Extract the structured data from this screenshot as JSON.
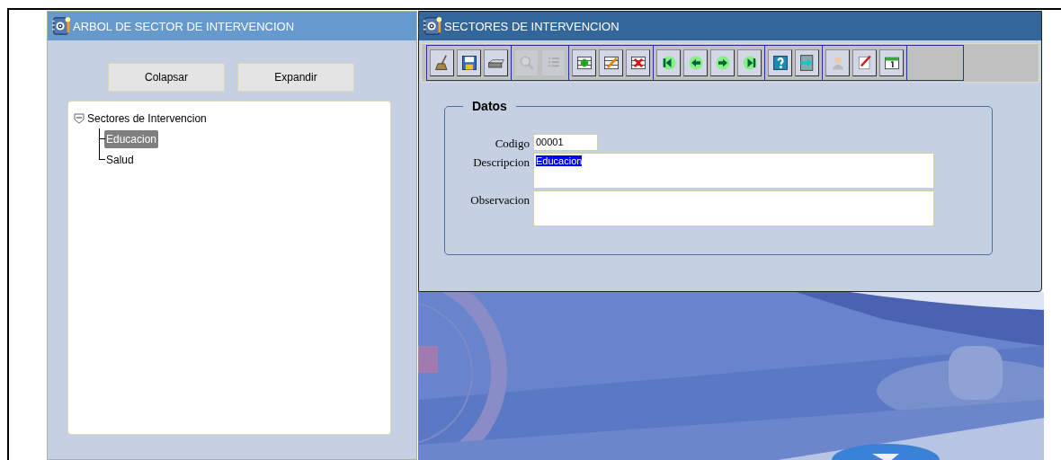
{
  "left_window": {
    "title": "ARBOL DE SECTOR DE INTERVENCION",
    "buttons": [
      "Colapsar",
      "Expandir"
    ],
    "tree": [
      {
        "label": "Sectores de Intervencion",
        "expanded": true,
        "selected": false,
        "children": [
          {
            "label": "Educacion",
            "selected": true
          },
          {
            "label": "Salud",
            "selected": false
          }
        ]
      }
    ]
  },
  "right_window": {
    "title": "SECTORES DE INTERVENCION",
    "toolbar": [
      [
        {
          "kind": "broom",
          "disabled": false
        },
        {
          "kind": "save",
          "disabled": false
        },
        {
          "kind": "printer",
          "disabled": false
        }
      ],
      [
        {
          "kind": "search",
          "disabled": true
        },
        {
          "kind": "list",
          "disabled": true
        }
      ],
      [
        {
          "kind": "insert",
          "disabled": false
        },
        {
          "kind": "edit",
          "disabled": false
        },
        {
          "kind": "delete",
          "disabled": false
        }
      ],
      [
        {
          "kind": "first",
          "disabled": false
        },
        {
          "kind": "prev",
          "disabled": false
        },
        {
          "kind": "next",
          "disabled": false
        },
        {
          "kind": "last",
          "disabled": false
        }
      ],
      [
        {
          "kind": "help",
          "disabled": false
        },
        {
          "kind": "exit",
          "disabled": false
        }
      ],
      [
        {
          "kind": "person",
          "disabled": false
        },
        {
          "kind": "check",
          "disabled": false
        },
        {
          "kind": "calendar",
          "disabled": false
        }
      ]
    ],
    "section": "Datos",
    "fields": [
      {
        "label": "Codigo",
        "value": "00001",
        "kind": "short",
        "selected": false
      },
      {
        "label": "Descripcion",
        "value": "Educacion",
        "kind": "long",
        "selected": true
      },
      {
        "label": "Observacion",
        "kind": "long"
      }
    ]
  }
}
